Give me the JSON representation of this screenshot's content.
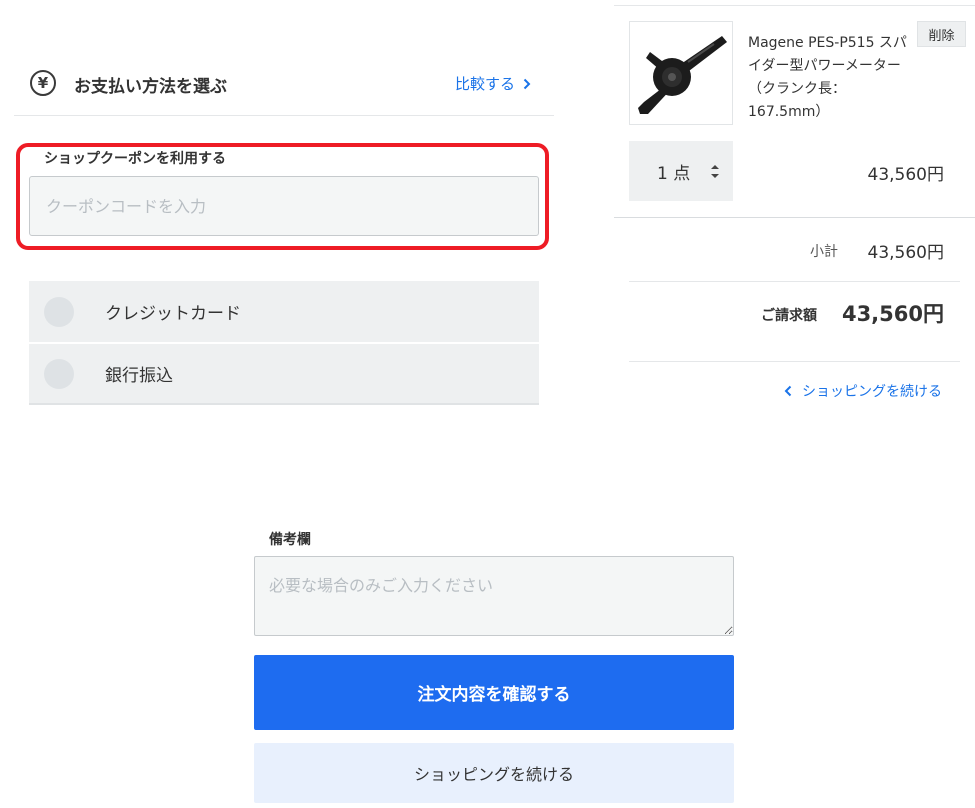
{
  "payment": {
    "icon": "yen-icon",
    "icon_glyph": "¥",
    "title": "お支払い方法を選ぶ",
    "compare_label": "比較する",
    "options": [
      {
        "label": "クレジットカード"
      },
      {
        "label": "銀行振込"
      }
    ]
  },
  "coupon": {
    "label": "ショップクーポンを利用する",
    "placeholder": "クーポンコードを入力",
    "highlight_color": "#ee1c25"
  },
  "cart": {
    "product_name": "Magene PES-P515 スパイダー型パワーメーター（クランク長：167.5mm）",
    "delete_label": "削除",
    "quantity_label": "1 点",
    "item_price": "43,560円",
    "subtotal_label": "小計",
    "subtotal_value": "43,560円",
    "total_label": "ご請求額",
    "total_value": "43,560円",
    "continue_link": "ショッピングを続ける"
  },
  "notes": {
    "label": "備考欄",
    "placeholder": "必要な場合のみご入力ください"
  },
  "actions": {
    "confirm_label": "注文内容を確認する",
    "continue_label": "ショッピングを続ける",
    "primary_color": "#1e6cf0"
  }
}
